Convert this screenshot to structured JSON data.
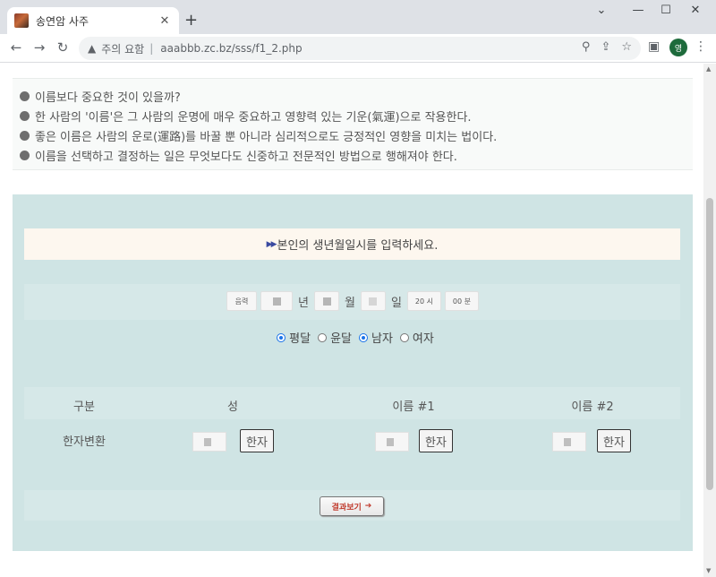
{
  "browser": {
    "tab_title": "송연암 사주",
    "newtab_icon": "plus-icon",
    "security_label": "주의 요함",
    "url": "aaabbb.zc.bz/sss/f1_2.php",
    "profile_initial": "영"
  },
  "info_lines": [
    "이름보다 중요한 것이 있을까?",
    "한 사람의 '이름'은 그 사람의 운명에 매우 중요하고 영향력 있는 기운(氣運)으로 작용한다.",
    "좋은 이름은 사람의 운로(運路)를 바꿀 뿐 아니라 심리적으로도 긍정적인 영향을 미치는 법이다.",
    "이름을 선택하고 결정하는 일은 무엇보다도 신중하고 전문적인 방법으로 행해져야 한다."
  ],
  "form": {
    "banner": "본인의 생년월일시를 입력하세요.",
    "calendar_select": "음력",
    "year_unit": "년",
    "month_unit": "월",
    "day_unit": "일",
    "hour_select": "20 시",
    "minute_select": "00 분",
    "radios": [
      {
        "label": "평달",
        "checked": true
      },
      {
        "label": "윤달",
        "checked": false
      },
      {
        "label": "남자",
        "checked": true
      },
      {
        "label": "여자",
        "checked": false
      }
    ],
    "headers": [
      "구분",
      "성",
      "이름 #1",
      "이름 #2"
    ],
    "row_label": "한자변환",
    "hanja_button": "한자",
    "result_button": "결과보기"
  },
  "colors": {
    "panel_bg": "#cfe4e4",
    "banner_bg": "#fdf7ef",
    "result_text": "#c0392b",
    "radio_accent": "#1a73e8"
  }
}
